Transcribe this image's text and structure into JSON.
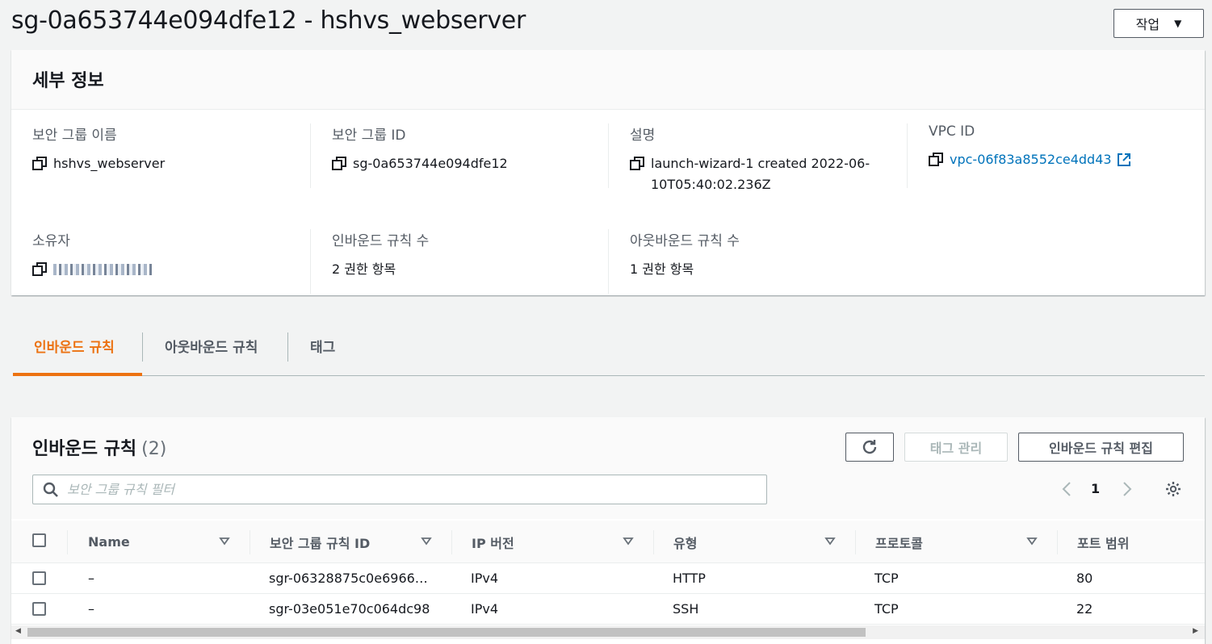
{
  "header": {
    "title": "sg-0a653744e094dfe12 - hshvs_webserver",
    "actions_label": "작업"
  },
  "details": {
    "heading": "세부 정보",
    "fields": [
      {
        "label": "보안 그룹 이름",
        "value": "hshvs_webserver"
      },
      {
        "label": "보안 그룹 ID",
        "value": "sg-0a653744e094dfe12"
      },
      {
        "label": "설명",
        "value": "launch-wizard-1 created 2022-06-10T05:40:02.236Z"
      },
      {
        "label": "VPC ID",
        "value": "vpc-06f83a8552ce4dd43"
      },
      {
        "label": "소유자",
        "value": ""
      },
      {
        "label": "인바운드 규칙 수",
        "value": "2 권한 항목"
      },
      {
        "label": "아웃바운드 규칙 수",
        "value": "1 권한 항목"
      }
    ]
  },
  "tabs": [
    {
      "label": "인바운드 규칙",
      "active": true
    },
    {
      "label": "아웃바운드 규칙",
      "active": false
    },
    {
      "label": "태그",
      "active": false
    }
  ],
  "rules": {
    "title": "인바운드 규칙",
    "count": "(2)",
    "manage_tags_label": "태그 관리",
    "edit_label": "인바운드 규칙 편집",
    "search_placeholder": "보안 그룹 규칙 필터",
    "page": "1",
    "columns": [
      "Name",
      "보안 그룹 규칙 ID",
      "IP 버전",
      "유형",
      "프로토콜",
      "포트 범위"
    ],
    "rows": [
      [
        "–",
        "sgr-06328875c0e6966…",
        "IPv4",
        "HTTP",
        "TCP",
        "80"
      ],
      [
        "–",
        "sgr-03e051e70c064dc98",
        "IPv4",
        "SSH",
        "TCP",
        "22"
      ]
    ]
  },
  "colors": {
    "accent": "#ec7211",
    "link": "#0073bb"
  }
}
